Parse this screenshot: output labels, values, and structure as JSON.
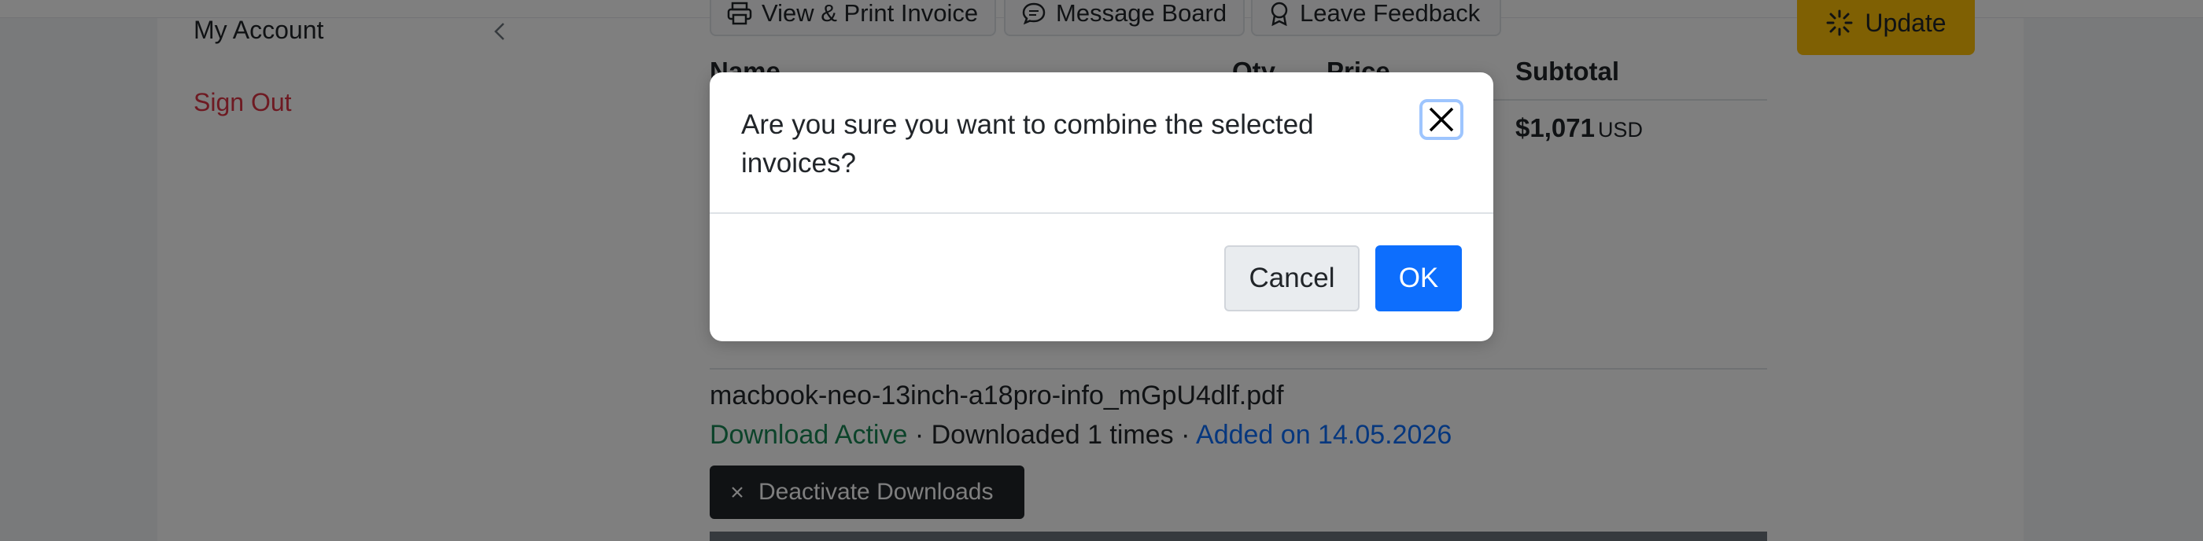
{
  "sidebar": {
    "items": [
      {
        "label": "My Account"
      },
      {
        "label": "Sign Out"
      }
    ]
  },
  "toolbar": {
    "view_print_label": "View & Print Invoice",
    "message_board_label": "Message Board",
    "leave_feedback_label": "Leave Feedback",
    "update_label": "Update"
  },
  "table": {
    "columns": [
      "Name",
      "Qty",
      "Price",
      "Subtotal"
    ],
    "subtotal_value": "$1,071",
    "subtotal_currency": "USD"
  },
  "download": {
    "file_name": "macbook-neo-13inch-a18pro-info_mGpU4dlf.pdf",
    "status": "Download Active",
    "separator": "·",
    "count_text": "Downloaded 1 times",
    "added_text": "Added on 14.05.2026",
    "deactivate_label": "Deactivate Downloads"
  },
  "modal": {
    "message": "Are you sure you want to combine the selected invoices?",
    "cancel_label": "Cancel",
    "ok_label": "OK"
  },
  "colors": {
    "danger": "#dc3545",
    "success": "#198754",
    "primary": "#0d6efd",
    "warning": "#ffc107",
    "dark": "#212529"
  },
  "icons": [
    "chevron-left-icon",
    "printer-icon",
    "chat-icon",
    "award-icon",
    "spinner-icon",
    "close-icon",
    "x-icon"
  ]
}
